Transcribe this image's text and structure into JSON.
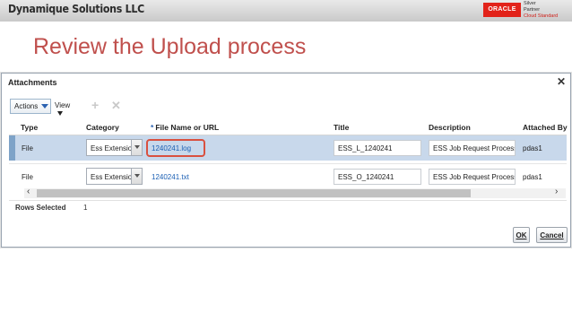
{
  "header": {
    "company": "Dynamique Solutions LLC",
    "oracle_badge": "ORACLE",
    "partner_lines": [
      "Silver",
      "Partner",
      "Cloud Standard"
    ]
  },
  "slide": {
    "title": "Review the Upload process"
  },
  "dialog": {
    "title": "Attachments",
    "close_glyph": "✕",
    "toolbar": {
      "actions_label": "Actions",
      "view_label": "View",
      "add_glyph": "+",
      "delete_glyph": "✕"
    },
    "columns": {
      "type": "Type",
      "category": "Category",
      "required_marker": "*",
      "file_name": "File Name or URL",
      "title": "Title",
      "description": "Description",
      "attached_by": "Attached By"
    },
    "rows": [
      {
        "type": "File",
        "category": "Ess Extension",
        "file_name": "1240241.log",
        "title": "ESS_L_1240241",
        "description": "ESS Job Request Process",
        "attached_by": "pdas1",
        "selected": true
      },
      {
        "type": "File",
        "category": "Ess Extension",
        "file_name": "1240241.txt",
        "title": "ESS_O_1240241",
        "description": "ESS Job Request Process",
        "attached_by": "pdas1",
        "selected": false
      }
    ],
    "scroll": {
      "left_arrow": "‹",
      "right_arrow": "›"
    },
    "footer": {
      "rows_selected_label": "Rows Selected",
      "rows_selected_count": "1"
    },
    "buttons": {
      "ok": "OK",
      "cancel": "Cancel"
    }
  },
  "colors": {
    "title_red": "#c0504d",
    "selected_row": "#c8d8eb",
    "link_blue": "#1a5fb4",
    "highlight_ring": "#d9503f",
    "oracle_red": "#e2231a"
  }
}
